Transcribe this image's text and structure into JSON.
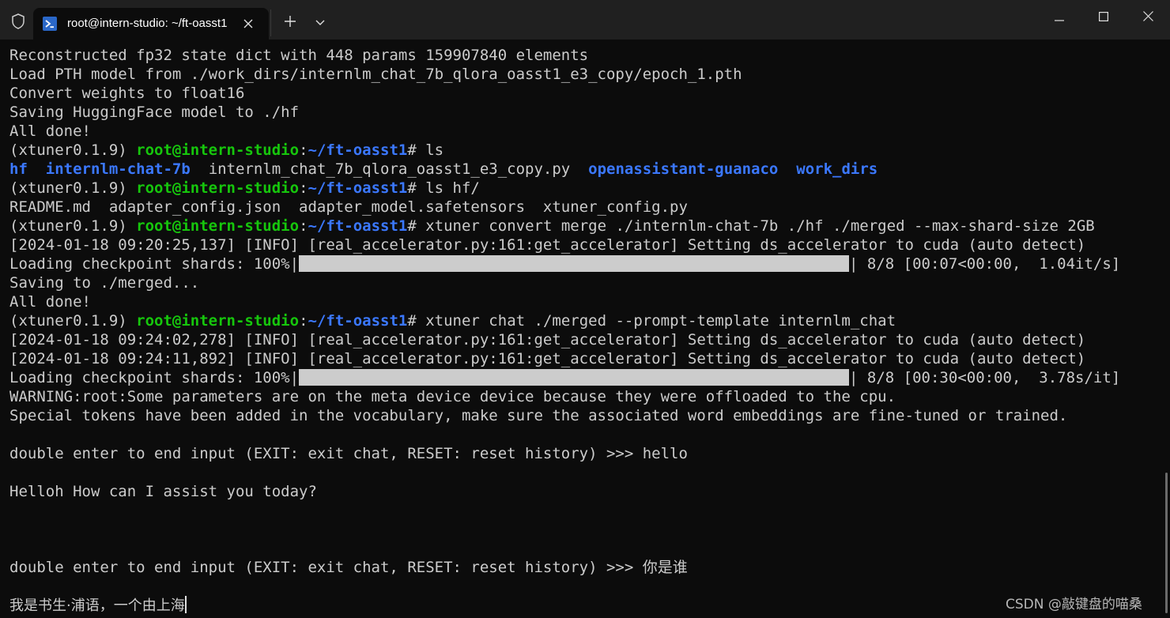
{
  "window": {
    "tab_title": "root@intern-studio: ~/ft-oasst1",
    "new_tab_glyph": "+"
  },
  "icons": {
    "shield": "shield-icon",
    "powershell": "powershell-icon",
    "close": "close-icon",
    "plus": "plus-icon",
    "chevron": "chevron-down-icon",
    "minimize": "minimize-icon",
    "maximize": "maximize-icon",
    "window_close": "window-close-icon"
  },
  "colors": {
    "background": "#0c0c0c",
    "titlebar": "#202020",
    "text": "#cccccc",
    "prompt_user": "#16c60c",
    "prompt_path": "#3b78ff",
    "directory": "#3b78ff"
  },
  "terminal": {
    "lines": [
      {
        "type": "text",
        "text": "Reconstructed fp32 state dict with 448 params 159907840 elements"
      },
      {
        "type": "text",
        "text": "Load PTH model from ./work_dirs/internlm_chat_7b_qlora_oasst1_e3_copy/epoch_1.pth"
      },
      {
        "type": "text",
        "text": "Convert weights to float16"
      },
      {
        "type": "text",
        "text": "Saving HuggingFace model to ./hf"
      },
      {
        "type": "text",
        "text": "All done!"
      },
      {
        "type": "prompt",
        "env": "(xtuner0.1.9) ",
        "user": "root@intern-studio",
        "sep": ":",
        "path": "~/ft-oasst1",
        "cmd": "# ls"
      },
      {
        "type": "listing",
        "items": [
          {
            "text": "hf",
            "dir": true
          },
          {
            "text": "  ",
            "dir": false
          },
          {
            "text": "internlm-chat-7b",
            "dir": true
          },
          {
            "text": "  internlm_chat_7b_qlora_oasst1_e3_copy.py  ",
            "dir": false
          },
          {
            "text": "openassistant-guanaco",
            "dir": true
          },
          {
            "text": "  ",
            "dir": false
          },
          {
            "text": "work_dirs",
            "dir": true
          }
        ]
      },
      {
        "type": "prompt",
        "env": "(xtuner0.1.9) ",
        "user": "root@intern-studio",
        "sep": ":",
        "path": "~/ft-oasst1",
        "cmd": "# ls hf/"
      },
      {
        "type": "text",
        "text": "README.md  adapter_config.json  adapter_model.safetensors  xtuner_config.py"
      },
      {
        "type": "prompt",
        "env": "(xtuner0.1.9) ",
        "user": "root@intern-studio",
        "sep": ":",
        "path": "~/ft-oasst1",
        "cmd": "# xtuner convert merge ./internlm-chat-7b ./hf ./merged --max-shard-size 2GB"
      },
      {
        "type": "text",
        "text": "[2024-01-18 09:20:25,137] [INFO] [real_accelerator.py:161:get_accelerator] Setting ds_accelerator to cuda (auto detect)"
      },
      {
        "type": "progress",
        "prefix": "Loading checkpoint shards: 100%|",
        "suffix": "| 8/8 [00:07<00:00,  1.04it/s]",
        "fraction": 1.0
      },
      {
        "type": "text",
        "text": "Saving to ./merged..."
      },
      {
        "type": "text",
        "text": "All done!"
      },
      {
        "type": "prompt",
        "env": "(xtuner0.1.9) ",
        "user": "root@intern-studio",
        "sep": ":",
        "path": "~/ft-oasst1",
        "cmd": "# xtuner chat ./merged --prompt-template internlm_chat"
      },
      {
        "type": "text",
        "text": "[2024-01-18 09:24:02,278] [INFO] [real_accelerator.py:161:get_accelerator] Setting ds_accelerator to cuda (auto detect)"
      },
      {
        "type": "text",
        "text": "[2024-01-18 09:24:11,892] [INFO] [real_accelerator.py:161:get_accelerator] Setting ds_accelerator to cuda (auto detect)"
      },
      {
        "type": "progress",
        "prefix": "Loading checkpoint shards: 100%|",
        "suffix": "| 8/8 [00:30<00:00,  3.78s/it]",
        "fraction": 1.0
      },
      {
        "type": "text",
        "text": "WARNING:root:Some parameters are on the meta device device because they were offloaded to the cpu."
      },
      {
        "type": "text",
        "text": "Special tokens have been added in the vocabulary, make sure the associated word embeddings are fine-tuned or trained."
      },
      {
        "type": "text",
        "text": ""
      },
      {
        "type": "text",
        "text": "double enter to end input (EXIT: exit chat, RESET: reset history) >>> hello"
      },
      {
        "type": "text",
        "text": ""
      },
      {
        "type": "text",
        "text": "Helloh How can I assist you today?"
      },
      {
        "type": "text",
        "text": ""
      },
      {
        "type": "text",
        "text": ""
      },
      {
        "type": "text",
        "text": ""
      },
      {
        "type": "text",
        "text": "double enter to end input (EXIT: exit chat, RESET: reset history) >>> 你是谁"
      },
      {
        "type": "text",
        "text": ""
      },
      {
        "type": "cursor",
        "text": "我是书生·浦语，一个由上海"
      }
    ]
  },
  "watermark": "CSDN @敲键盘的喵桑"
}
